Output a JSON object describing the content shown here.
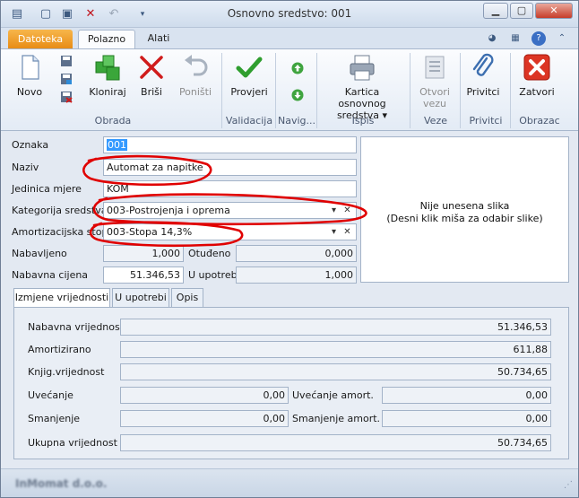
{
  "window": {
    "title": "Osnovno sredstvo: 001",
    "qa_icons": [
      "document-icon",
      "save-icon",
      "delete-icon",
      "undo-icon",
      "dropdown-icon"
    ]
  },
  "tabs": {
    "file": "Datoteka",
    "items": [
      "Polazno",
      "Alati"
    ]
  },
  "ribbon": {
    "groups": {
      "obrada": "Obrada",
      "validacija": "Validacija",
      "navigacija": "Navig...",
      "ispis": "Ispis",
      "veze": "Veze",
      "privitci": "Privitci",
      "obrazac": "Obrazac"
    },
    "buttons": {
      "novo": "Novo",
      "kloniraj": "Kloniraj",
      "brisi": "Briši",
      "ponisti": "Poništi",
      "provjeri": "Provjeri",
      "kartica_line1": "Kartica osnovnog",
      "kartica_line2": "sredstva ▾",
      "otvori_line1": "Otvori",
      "otvori_line2": "vezu",
      "privitci": "Privitci",
      "zatvori": "Zatvori"
    }
  },
  "form": {
    "oznaka_label": "Oznaka",
    "oznaka_value": "001",
    "naziv_label": "Naziv",
    "naziv_value": "Automat za napitke",
    "jedinica_label": "Jedinica mjere",
    "jedinica_value": "KOM",
    "kategorija_label": "Kategorija sredstva",
    "kategorija_value": "003-Postrojenja i oprema",
    "amortizacija_label": "Amortizacijska stopa",
    "amortizacija_value": "003-Stopa 14,3%",
    "nabavljeno_label": "Nabavljeno",
    "nabavljeno_value": "1,000",
    "otudjeno_label": "Otuđeno",
    "otudjeno_value": "0,000",
    "nabavna_cijena_label": "Nabavna cijena",
    "nabavna_cijena_value": "51.346,53",
    "u_upotrebi_label": "U upotrebi",
    "u_upotrebi_value": "1,000"
  },
  "image": {
    "line1": "Nije unesena slika",
    "line2": "(Desni klik miša za odabir slike)"
  },
  "detail_tabs": [
    "Izmjene vrijednosti",
    "U upotrebi",
    "Opis"
  ],
  "values": {
    "nabavna_vrijednost_label": "Nabavna vrijednost",
    "nabavna_vrijednost": "51.346,53",
    "amortizirano_label": "Amortizirano",
    "amortizirano": "611,88",
    "knjig_label": "Knjig.vrijednost",
    "knjig": "50.734,65",
    "uvecanje_label": "Uvećanje",
    "uvecanje": "0,00",
    "uvecanje_amort_label": "Uvećanje amort.",
    "uvecanje_amort": "0,00",
    "smanjenje_label": "Smanjenje",
    "smanjenje": "0,00",
    "smanjenje_amort_label": "Smanjenje amort.",
    "smanjenje_amort": "0,00",
    "ukupna_label": "Ukupna vrijednost",
    "ukupna": "50.734,65"
  },
  "status": {
    "company": "InMomat d.o.o."
  },
  "colors": {
    "annotation": "#e00000",
    "file_tab": "#e78a13",
    "selection": "#3399ff"
  }
}
